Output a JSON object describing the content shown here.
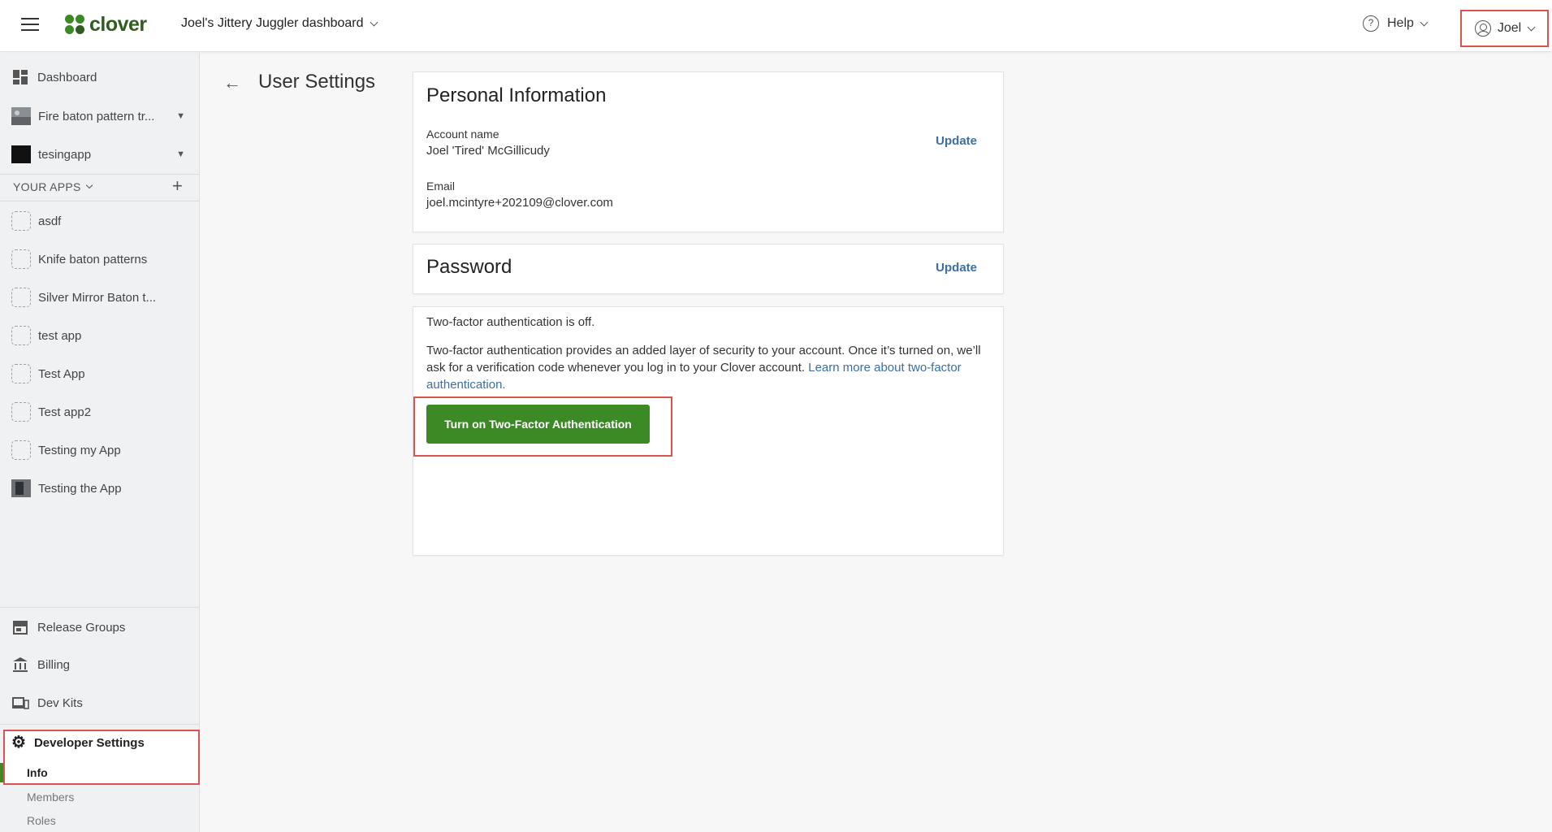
{
  "header": {
    "logo_text": "clover",
    "dashboard_title": "Joel's Jittery Juggler dashboard",
    "help_label": "Help",
    "help_icon_glyph": "?",
    "user_label": "Joel"
  },
  "sidebar": {
    "top_items": [
      {
        "label": "Dashboard",
        "icon": "dashboard-icon"
      },
      {
        "label": "Fire baton pattern tr...",
        "icon": "app-thumbnail"
      },
      {
        "label": "tesingapp",
        "icon": "app-thumbnail"
      }
    ],
    "your_apps_label": "YOUR APPS",
    "apps": [
      "asdf",
      "Knife baton patterns",
      "Silver Mirror Baton t...",
      "test app",
      "Test App",
      "Test app2",
      "Testing my App",
      "Testing the App"
    ],
    "bottom_items": [
      {
        "label": "Release Groups",
        "icon": "store-icon"
      },
      {
        "label": "Billing",
        "icon": "bank-icon"
      },
      {
        "label": "Dev Kits",
        "icon": "devices-icon"
      }
    ],
    "developer_settings_label": "Developer Settings",
    "sub_items": [
      "Info",
      "Members",
      "Roles"
    ]
  },
  "main": {
    "page_title": "User Settings",
    "personal_info": {
      "heading": "Personal Information",
      "account_name_label": "Account name",
      "account_name_value": "Joel 'Tired' McGillicudy",
      "update_label": "Update",
      "email_label": "Email",
      "email_value": "joel.mcintyre+202109@clover.com"
    },
    "password": {
      "heading": "Password",
      "update_label": "Update"
    },
    "two_factor": {
      "status": "Two-factor authentication is off.",
      "description": "Two-factor authentication provides an added layer of security to your account. Once it’s turned on, we’ll ask for a verification code whenever you log in to your Clover account. ",
      "learn_more": "Learn more about two-factor authentication.",
      "button_label": "Turn on Two-Factor Authentication"
    }
  },
  "colors": {
    "brand_green": "#3b8a25",
    "link_blue": "#3a6ea5",
    "highlight_red": "#d9534f"
  }
}
